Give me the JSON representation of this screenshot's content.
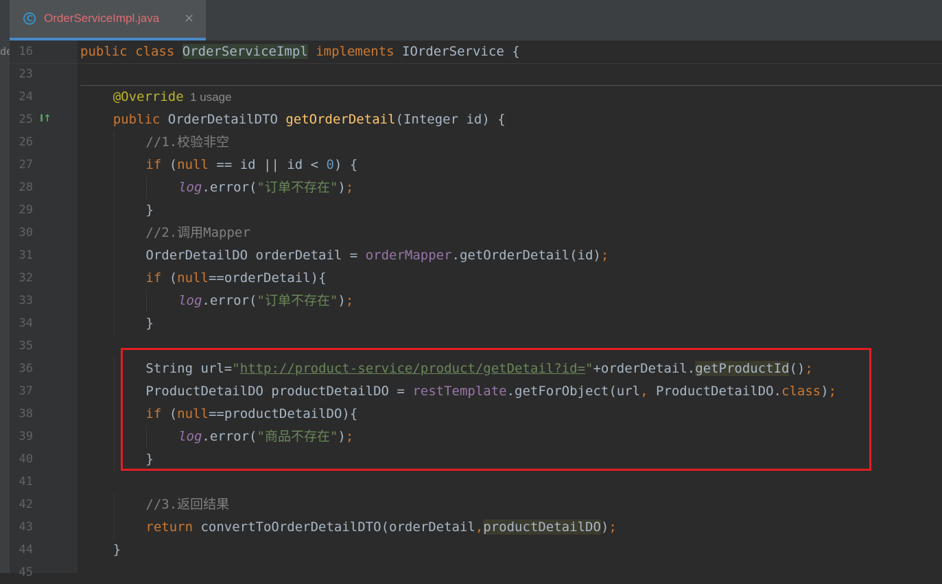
{
  "tab": {
    "title": "OrderServiceImpl.java",
    "close": "×",
    "icon_label": "C"
  },
  "side_label": "de",
  "gutter_marker": "I↑",
  "sticky": {
    "line_number": "16",
    "tokens": [
      {
        "t": "public ",
        "c": "kw"
      },
      {
        "t": "class ",
        "c": "kw"
      },
      {
        "t": "OrderServiceImpl",
        "c": "hlc"
      },
      {
        "t": " ",
        "c": "id"
      },
      {
        "t": "implements ",
        "c": "kw"
      },
      {
        "t": "IOrderService {",
        "c": "id"
      }
    ]
  },
  "lines": [
    {
      "n": "23",
      "indent": 0,
      "tokens": []
    },
    {
      "n": "24",
      "indent": 1,
      "tokens": [
        {
          "t": "@Override",
          "c": "ann"
        },
        {
          "t": "  1 usage",
          "c": "hint"
        }
      ]
    },
    {
      "n": "25",
      "indent": 1,
      "tokens": [
        {
          "t": "public ",
          "c": "kw"
        },
        {
          "t": "OrderDetailDTO ",
          "c": "cls"
        },
        {
          "t": "getOrderDetail",
          "c": "fn"
        },
        {
          "t": "(Integer id) {",
          "c": "id"
        }
      ]
    },
    {
      "n": "26",
      "indent": 2,
      "tokens": [
        {
          "t": "//1.校验非空",
          "c": "cmt"
        }
      ]
    },
    {
      "n": "27",
      "indent": 2,
      "tokens": [
        {
          "t": "if ",
          "c": "kw"
        },
        {
          "t": "(",
          "c": "id"
        },
        {
          "t": "null ",
          "c": "kw"
        },
        {
          "t": "== id || id < ",
          "c": "id"
        },
        {
          "t": "0",
          "c": "num"
        },
        {
          "t": ") {",
          "c": "id"
        }
      ]
    },
    {
      "n": "28",
      "indent": 3,
      "tokens": [
        {
          "t": "log",
          "c": "fldi"
        },
        {
          "t": ".error(",
          "c": "id"
        },
        {
          "t": "\"订单不存在\"",
          "c": "str"
        },
        {
          "t": ")",
          "c": "id"
        },
        {
          "t": ";",
          "c": "kw"
        }
      ]
    },
    {
      "n": "29",
      "indent": 2,
      "tokens": [
        {
          "t": "}",
          "c": "id"
        }
      ]
    },
    {
      "n": "30",
      "indent": 2,
      "tokens": [
        {
          "t": "//2.调用Mapper",
          "c": "cmt"
        }
      ]
    },
    {
      "n": "31",
      "indent": 2,
      "tokens": [
        {
          "t": "OrderDetailDO orderDetail = ",
          "c": "id"
        },
        {
          "t": "orderMapper",
          "c": "fld"
        },
        {
          "t": ".getOrderDetail(id)",
          "c": "id"
        },
        {
          "t": ";",
          "c": "kw"
        }
      ]
    },
    {
      "n": "32",
      "indent": 2,
      "tokens": [
        {
          "t": "if ",
          "c": "kw"
        },
        {
          "t": "(",
          "c": "id"
        },
        {
          "t": "null",
          "c": "kw"
        },
        {
          "t": "==orderDetail){",
          "c": "id"
        }
      ]
    },
    {
      "n": "33",
      "indent": 3,
      "tokens": [
        {
          "t": "log",
          "c": "fldi"
        },
        {
          "t": ".error(",
          "c": "id"
        },
        {
          "t": "\"订单不存在\"",
          "c": "str"
        },
        {
          "t": ")",
          "c": "id"
        },
        {
          "t": ";",
          "c": "kw"
        }
      ]
    },
    {
      "n": "34",
      "indent": 2,
      "tokens": [
        {
          "t": "}",
          "c": "id"
        }
      ]
    },
    {
      "n": "35",
      "indent": 0,
      "tokens": []
    },
    {
      "n": "36",
      "indent": 2,
      "tokens": [
        {
          "t": "String url=",
          "c": "id"
        },
        {
          "t": "\"",
          "c": "str"
        },
        {
          "t": "http://product-service/product/getDetail?id=",
          "c": "url"
        },
        {
          "t": "\"",
          "c": "str"
        },
        {
          "t": "+orderDetail.",
          "c": "id"
        },
        {
          "t": "getProductId",
          "c": "hl"
        },
        {
          "t": "()",
          "c": "id"
        },
        {
          "t": ";",
          "c": "kw"
        }
      ]
    },
    {
      "n": "37",
      "indent": 2,
      "tokens": [
        {
          "t": "ProductDetailDO productDetailDO = ",
          "c": "id"
        },
        {
          "t": "restTemplate",
          "c": "fld"
        },
        {
          "t": ".getForObject(url",
          "c": "id"
        },
        {
          "t": ", ",
          "c": "kw"
        },
        {
          "t": "ProductDetailDO.",
          "c": "id"
        },
        {
          "t": "class",
          "c": "kw"
        },
        {
          "t": ")",
          "c": "id"
        },
        {
          "t": ";",
          "c": "kw"
        }
      ]
    },
    {
      "n": "38",
      "indent": 2,
      "tokens": [
        {
          "t": "if ",
          "c": "kw"
        },
        {
          "t": "(",
          "c": "id"
        },
        {
          "t": "null",
          "c": "kw"
        },
        {
          "t": "==productDetailDO){",
          "c": "id"
        }
      ]
    },
    {
      "n": "39",
      "indent": 3,
      "tokens": [
        {
          "t": "log",
          "c": "fldi"
        },
        {
          "t": ".error(",
          "c": "id"
        },
        {
          "t": "\"商品不存在\"",
          "c": "str"
        },
        {
          "t": ")",
          "c": "id"
        },
        {
          "t": ";",
          "c": "kw"
        }
      ]
    },
    {
      "n": "40",
      "indent": 2,
      "tokens": [
        {
          "t": "}",
          "c": "id"
        }
      ]
    },
    {
      "n": "41",
      "indent": 0,
      "tokens": []
    },
    {
      "n": "42",
      "indent": 2,
      "tokens": [
        {
          "t": "//3.返回结果",
          "c": "cmt"
        }
      ]
    },
    {
      "n": "43",
      "indent": 2,
      "tokens": [
        {
          "t": "return ",
          "c": "kw"
        },
        {
          "t": "convertToOrderDetailDTO(orderDetail",
          "c": "id"
        },
        {
          "t": ",",
          "c": "kw"
        },
        {
          "t": "productDetailDO",
          "c": "hl"
        },
        {
          "t": ")",
          "c": "id"
        },
        {
          "t": ";",
          "c": "kw"
        }
      ]
    },
    {
      "n": "44",
      "indent": 1,
      "tokens": [
        {
          "t": "}",
          "c": "id"
        }
      ]
    },
    {
      "n": "45",
      "indent": 0,
      "tokens": []
    }
  ],
  "colors": {
    "background": "#2b2b2b",
    "keyword": "#cc7832",
    "string": "#6a8759",
    "comment": "#808080",
    "function": "#ffc66d",
    "field": "#9876aa",
    "annotation": "#bbb529",
    "number": "#6897bb",
    "highlight_box": "#e51c23"
  }
}
